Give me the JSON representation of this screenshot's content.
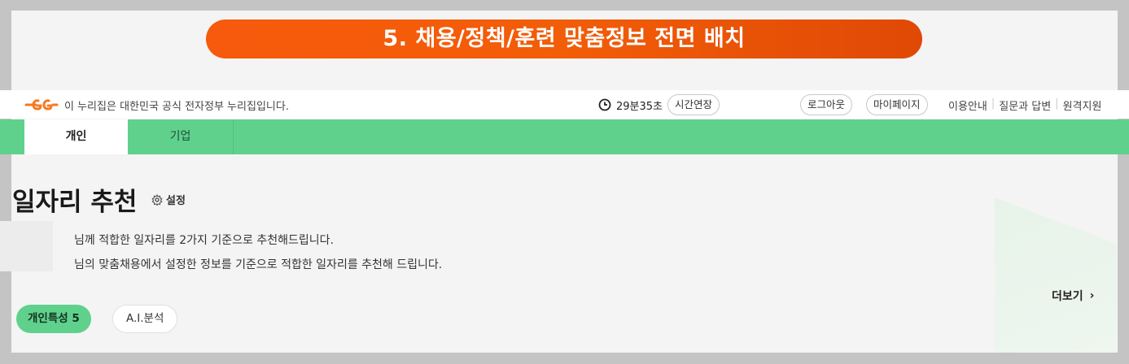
{
  "banner": {
    "title": "5. 채용/정책/훈련 맞춤정보 전면 배치"
  },
  "gov_bar": {
    "logo_icon": "nuri-logo-icon",
    "notice": "이 누리집은 대한민국 공식 전자정부 누리집입니다.",
    "timer": {
      "icon": "clock-icon",
      "time": "29분35초",
      "extend_label": "시간연장"
    },
    "logout_label": "로그아웃",
    "mypage_label": "마이페이지",
    "links": [
      "이용안내",
      "질문과 답변",
      "원격지원"
    ]
  },
  "tabs": {
    "personal": "개인",
    "company": "기업"
  },
  "section": {
    "title": "일자리 추천",
    "settings_icon": "gear-icon",
    "settings_label": "설정",
    "desc1": "님께 적합한 일자리를 2가지 기준으로 추천해드립니다.",
    "desc2": "님의 맞춤채용에서 설정한 정보를 기준으로 적합한 일자리를 추천해 드립니다.",
    "more_label": "더보기",
    "more_icon": "chevron-right-icon",
    "chips": {
      "personal": "개인특성 5",
      "ai": "A.I.분석"
    }
  },
  "colors": {
    "banner_orange": "#f75a0c",
    "tab_green": "#5fd18d",
    "logo_orange": "#f47a20"
  }
}
